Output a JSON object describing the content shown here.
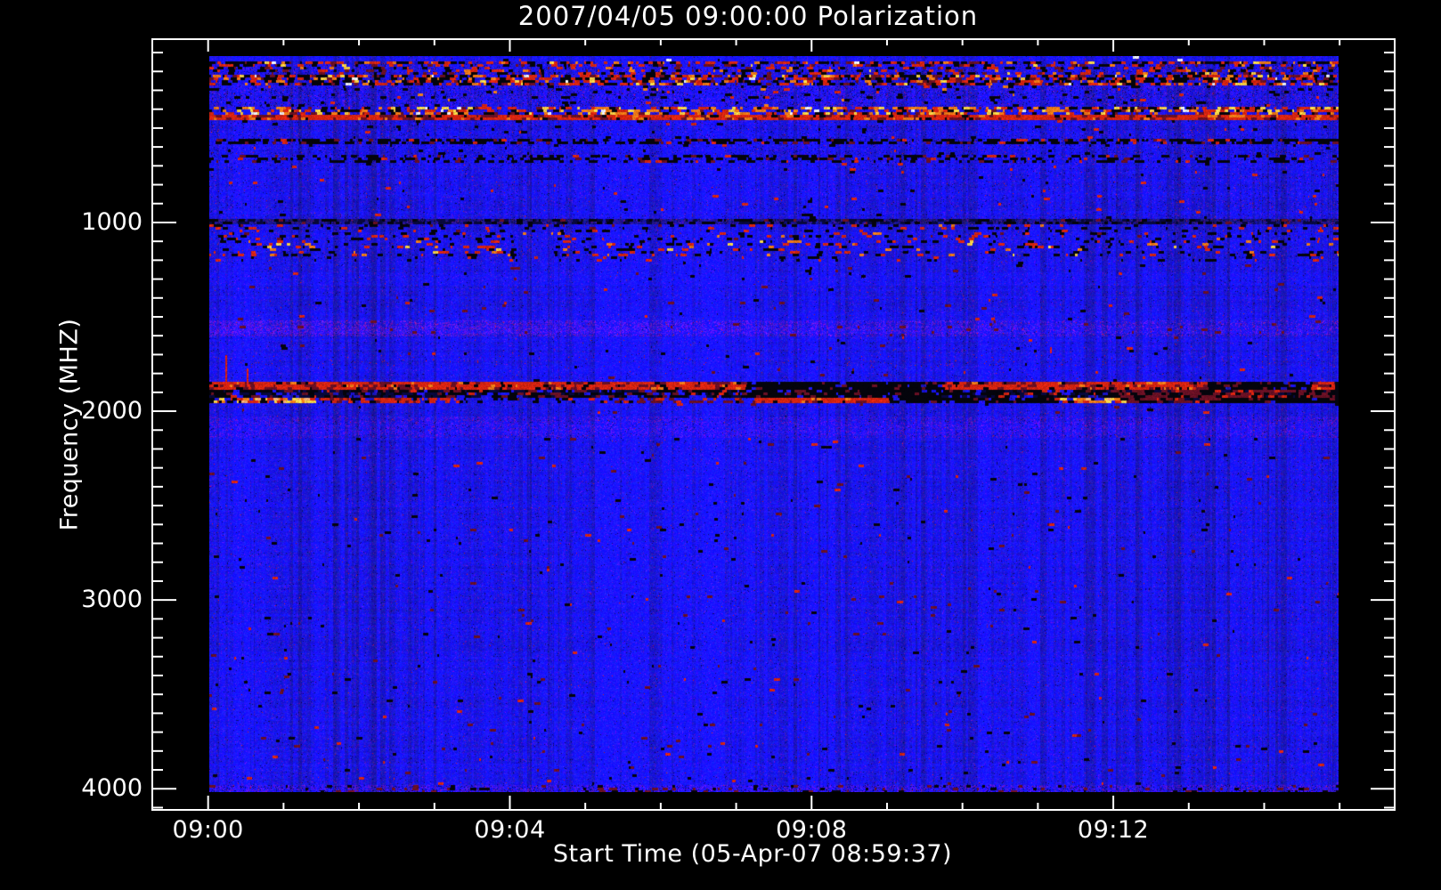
{
  "window": {
    "background": "#000000"
  },
  "chart_data": {
    "type": "heatmap",
    "subtype": "radio-spectrogram",
    "title": "2007/04/05 09:00:00 Polarization",
    "xlabel": "Start Time (05-Apr-07 08:59:37)",
    "ylabel": "Frequency (MHZ)",
    "legend": "none",
    "grid": false,
    "colors": {
      "axis": "#ffffff",
      "text": "#ffffff",
      "background": "#000000",
      "base_blue": "#1d1df0"
    },
    "x_axis": {
      "min_minutes": -0.74,
      "max_minutes": 15.73,
      "major_ticks": [
        {
          "minutes": 0,
          "label": "09:00"
        },
        {
          "minutes": 4,
          "label": "09:04"
        },
        {
          "minutes": 8,
          "label": "09:08"
        },
        {
          "minutes": 12,
          "label": "09:12"
        }
      ],
      "minor_tick_step_minutes": 1,
      "minor_tick_range_minutes": [
        0,
        15
      ]
    },
    "y_axis": {
      "unit": "MHz",
      "direction": "increasing-downward",
      "min": 29,
      "max": 4112,
      "major_ticks": [
        {
          "value": 1000,
          "label": "1000"
        },
        {
          "value": 2000,
          "label": "2000"
        },
        {
          "value": 3000,
          "label": "3000"
        },
        {
          "value": 4000,
          "label": "4000"
        }
      ],
      "minor_tick_step": 100,
      "minor_tick_range": [
        100,
        4100
      ]
    },
    "image": {
      "time_min_minutes": 0,
      "time_max_minutes": 14.97,
      "freq_min_mhz": 118,
      "freq_max_mhz": 4017,
      "base_color": "#1d1df0",
      "palette": {
        "bg": "#1d1df0",
        "black": "#04040c",
        "navy": "#08083c",
        "red": "#d62410",
        "darkred": "#691024",
        "orange": "#f27a16",
        "yellow": "#ffd246",
        "peach": "#ffb078",
        "white": "#f0f4ff",
        "purple": "#5428b4"
      },
      "bands": [
        {
          "f0": 118,
          "f1": 140,
          "style": "top_edge"
        },
        {
          "f0": 140,
          "f1": 162,
          "style": "rfi_dense"
        },
        {
          "f0": 162,
          "f1": 222,
          "style": "rfi_medium"
        },
        {
          "f0": 222,
          "f1": 268,
          "style": "rfi_dense"
        },
        {
          "f0": 268,
          "f1": 386,
          "style": "mottled_dark"
        },
        {
          "f0": 386,
          "f1": 428,
          "style": "speckle_bright"
        },
        {
          "f0": 428,
          "f1": 452,
          "style": "red_line"
        },
        {
          "f0": 452,
          "f1": 556,
          "style": "mottled"
        },
        {
          "f0": 556,
          "f1": 590,
          "style": "dark_dashes"
        },
        {
          "f0": 590,
          "f1": 645,
          "style": "mottled"
        },
        {
          "f0": 645,
          "f1": 680,
          "style": "dark_dashes_light"
        },
        {
          "f0": 680,
          "f1": 980,
          "style": "mottled_light"
        },
        {
          "f0": 980,
          "f1": 1012,
          "style": "dark_navy_row"
        },
        {
          "f0": 1012,
          "f1": 1092,
          "style": "sparse_dashes"
        },
        {
          "f0": 1092,
          "f1": 1172,
          "style": "sparse_dashes_bright"
        },
        {
          "f0": 1172,
          "f1": 1205,
          "style": "sparse_dashes_light"
        },
        {
          "f0": 1520,
          "f1": 1605,
          "style": "pink_faint"
        },
        {
          "f0": 1705,
          "f1": 1775,
          "style": "sparse_red_dots"
        },
        {
          "f0": 1843,
          "f1": 1880,
          "style": "segmented",
          "segments": [
            {
              "t0": 0,
              "t1": 7.1,
              "c": "red_seg"
            },
            {
              "t0": 7.1,
              "t1": 9.7,
              "c": "black_seg"
            },
            {
              "t0": 9.7,
              "t1": 13.2,
              "c": "red_seg"
            },
            {
              "t0": 13.2,
              "t1": 14.6,
              "c": "black_seg"
            },
            {
              "t0": 14.6,
              "t1": 14.97,
              "c": "red_seg"
            }
          ]
        },
        {
          "f0": 1880,
          "f1": 1926,
          "style": "segmented",
          "segments": [
            {
              "t0": 0,
              "t1": 7.1,
              "c": "mix_dark"
            },
            {
              "t0": 7.1,
              "t1": 9.7,
              "c": "black_seg"
            },
            {
              "t0": 9.7,
              "t1": 12.0,
              "c": "mix_dark"
            },
            {
              "t0": 12.0,
              "t1": 14.97,
              "c": "dark_maroon"
            }
          ]
        },
        {
          "f0": 1926,
          "f1": 1962,
          "style": "segmented",
          "segments": [
            {
              "t0": 0,
              "t1": 0.4,
              "c": "mix"
            },
            {
              "t0": 0.4,
              "t1": 1.4,
              "c": "bright"
            },
            {
              "t0": 1.4,
              "t1": 3.2,
              "c": "red_dash"
            },
            {
              "t0": 3.2,
              "t1": 5.3,
              "c": "sparse"
            },
            {
              "t0": 5.3,
              "t1": 7.2,
              "c": "faint_red"
            },
            {
              "t0": 7.2,
              "t1": 9.0,
              "c": "red_seg"
            },
            {
              "t0": 9.0,
              "t1": 11.2,
              "c": "black_seg"
            },
            {
              "t0": 11.2,
              "t1": 12.1,
              "c": "bright"
            },
            {
              "t0": 12.1,
              "t1": 13.3,
              "c": "dark_maroon"
            },
            {
              "t0": 13.3,
              "t1": 14.97,
              "c": "black_seg"
            }
          ]
        },
        {
          "f0": 2030,
          "f1": 2140,
          "style": "purple_faint"
        },
        {
          "f0": 3985,
          "f1": 4017,
          "style": "bottom_edge"
        }
      ],
      "spikes": [
        {
          "t": 0.21,
          "f0": 1700,
          "f1": 1862
        },
        {
          "t": 0.5,
          "f0": 1772,
          "f1": 1862
        },
        {
          "t": 11.14,
          "f0": 1662,
          "f1": 1688
        }
      ],
      "right_edge_dark": {
        "t0": 14.93,
        "t1": 14.97,
        "f0": 1843,
        "f1": 1965
      }
    }
  }
}
